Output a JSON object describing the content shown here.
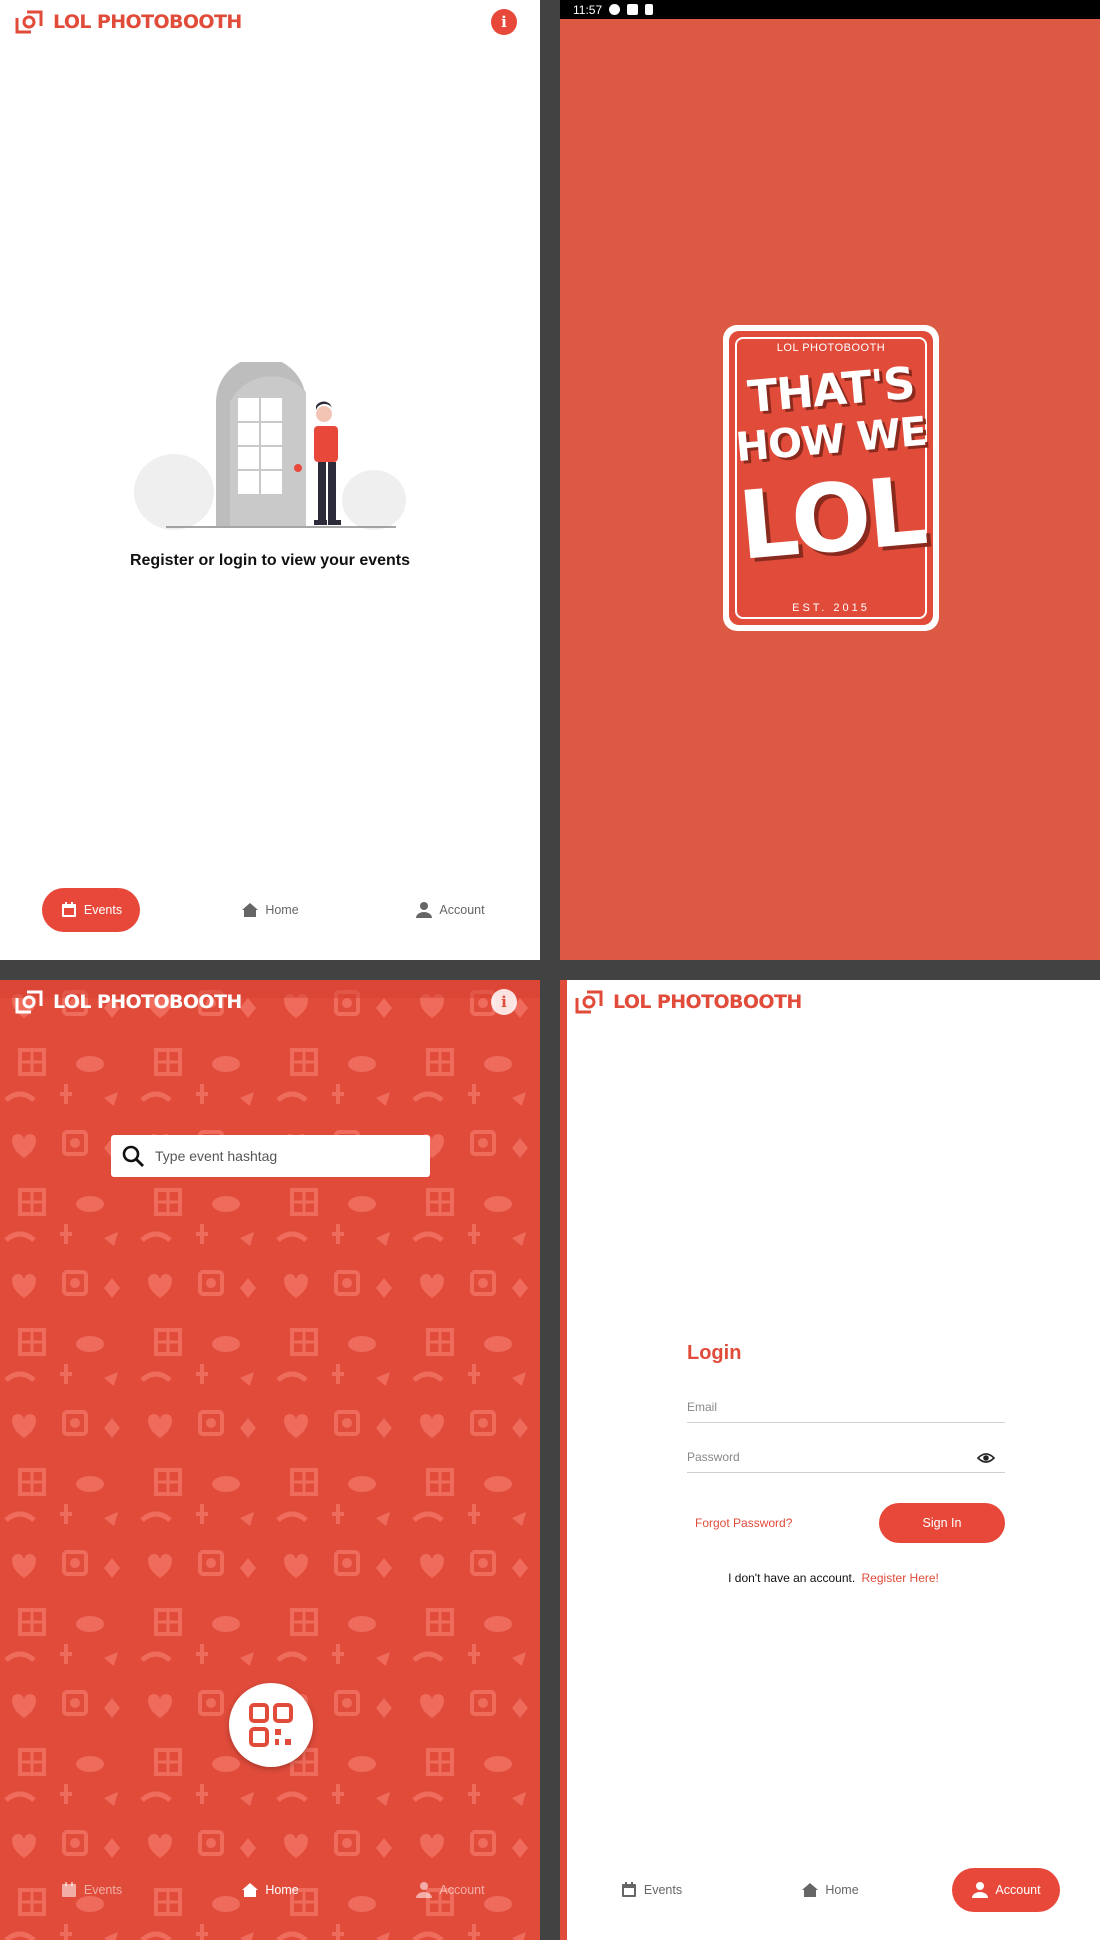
{
  "brand": {
    "name": "LOL PHOTOBOOTH",
    "color": "#e04b3a"
  },
  "events_screen": {
    "empty_message": "Register or login to view your events",
    "info_icon": "info-icon"
  },
  "nav": {
    "events": "Events",
    "home": "Home",
    "account": "Account"
  },
  "splash": {
    "status_time": "11:57",
    "badge_top": "LOL PHOTOBOOTH",
    "line1": "THAT'S",
    "line2": "HOW WE",
    "line3": "LOL",
    "badge_bottom": "EST. 2015"
  },
  "home_screen": {
    "search_placeholder": "Type event hashtag",
    "scan_icon": "qr-code-icon"
  },
  "login_screen": {
    "title": "Login",
    "email_placeholder": "Email",
    "password_placeholder": "Password",
    "forgot_password": "Forgot Password?",
    "sign_in": "Sign In",
    "no_account": "I don't have an account.",
    "register_link": "Register Here!"
  },
  "active_tabs": {
    "events_screen": "Events",
    "home_screen": "Home",
    "login_screen": "Account"
  }
}
